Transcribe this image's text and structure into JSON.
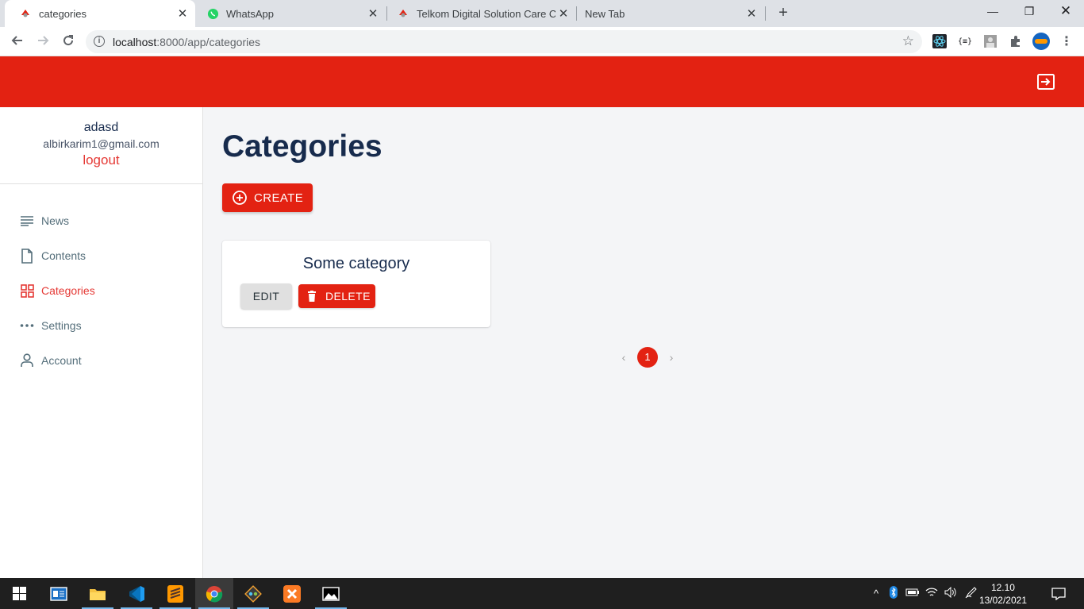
{
  "browser": {
    "tabs": [
      {
        "title": "categories",
        "active": true
      },
      {
        "title": "WhatsApp",
        "active": false
      },
      {
        "title": "Telkom Digital Solution Care Cen",
        "active": false
      },
      {
        "title": "New Tab",
        "active": false
      }
    ],
    "url_host": "localhost",
    "url_path": ":8000/app/categories"
  },
  "user": {
    "name": "adasd",
    "email": "albirkarim1@gmail.com",
    "logout_label": "logout"
  },
  "nav": {
    "items": [
      {
        "label": "News",
        "icon": "news-icon",
        "active": false
      },
      {
        "label": "Contents",
        "icon": "file-icon",
        "active": false
      },
      {
        "label": "Categories",
        "icon": "grid-icon",
        "active": true
      },
      {
        "label": "Settings",
        "icon": "more-icon",
        "active": false
      },
      {
        "label": "Account",
        "icon": "person-icon",
        "active": false
      }
    ]
  },
  "main": {
    "title": "Categories",
    "create_label": "CREATE",
    "card": {
      "name": "Some category",
      "edit_label": "EDIT",
      "delete_label": "DELETE"
    },
    "pagination": {
      "current_page": "1"
    }
  },
  "taskbar": {
    "time": "12.10",
    "date": "13/02/2021"
  },
  "colors": {
    "accent": "#e32212",
    "text_dark": "#172b4d"
  }
}
